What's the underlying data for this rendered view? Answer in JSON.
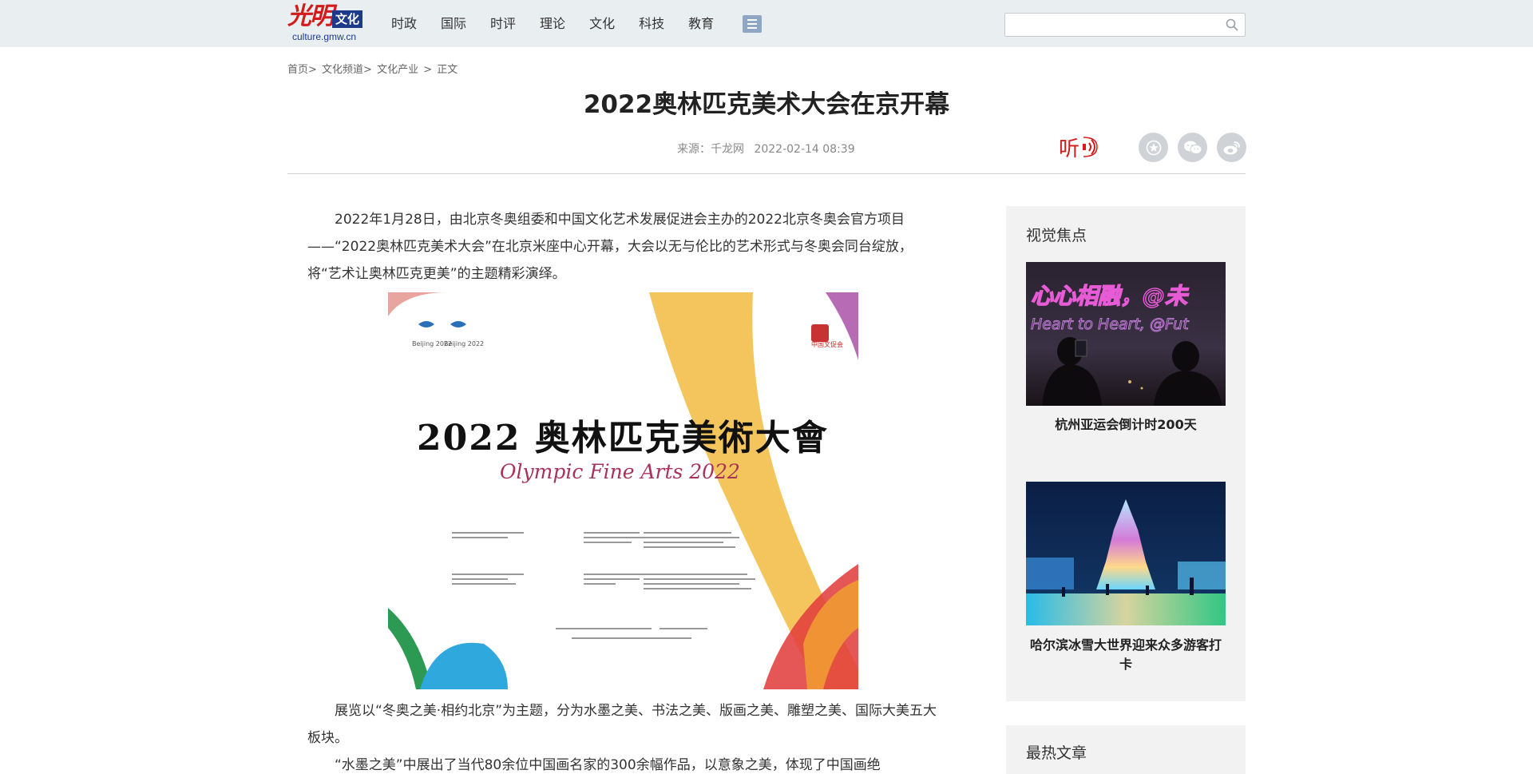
{
  "header": {
    "logo_brush": "光明",
    "logo_tag": "文化",
    "logo_url": "culture.gmw.cn",
    "nav": [
      "时政",
      "国际",
      "时评",
      "理论",
      "文化",
      "科技",
      "教育"
    ],
    "search_placeholder": ""
  },
  "breadcrumb": [
    "首页>",
    "文化频道>",
    "文化产业",
    ">",
    "正文"
  ],
  "article": {
    "title": "2022奥林匹克美术大会在京开幕",
    "source": "来源：千龙网",
    "datetime": "2022-02-14 08:39",
    "listen_label": "听",
    "paragraphs": [
      "2022年1月28日，由北京冬奥组委和中国文化艺术发展促进会主办的2022北京冬奥会官方项目——“2022奥林匹克美术大会”在北京米座中心开幕，大会以无与伦比的艺术形式与冬奥会同台绽放，将“艺术让奥林匹克更美”的主题精彩演绎。",
      "展览以“冬奥之美·相约北京”为主题，分为水墨之美、书法之美、版画之美、雕塑之美、国际大美五大板块。",
      "“水墨之美”中展出了当代80余位中国画名家的300余幅作品，以意象之美，体现了中国画绝"
    ],
    "poster": {
      "title": "2022 奥林匹克美術大會",
      "subtitle": "Olympic Fine Arts 2022",
      "logo_left_1": "Beijing 2022",
      "logo_left_2": "Beijing 2022",
      "logo_right": "中国文促会"
    }
  },
  "sidebar": {
    "focus_title": "视觉焦点",
    "focus_items": [
      {
        "caption": "杭州亚运会倒计时200天",
        "banner_cn": "心心相融，@未",
        "banner_en": "Heart to Heart, @Fut"
      },
      {
        "caption": "哈尔滨冰雪大世界迎来众多游客打卡"
      }
    ],
    "hot_title": "最热文章"
  },
  "colors": {
    "accent_red": "#d31b1b",
    "logo_blue": "#1d3a8a",
    "topbar_bg": "#e9eef1"
  }
}
